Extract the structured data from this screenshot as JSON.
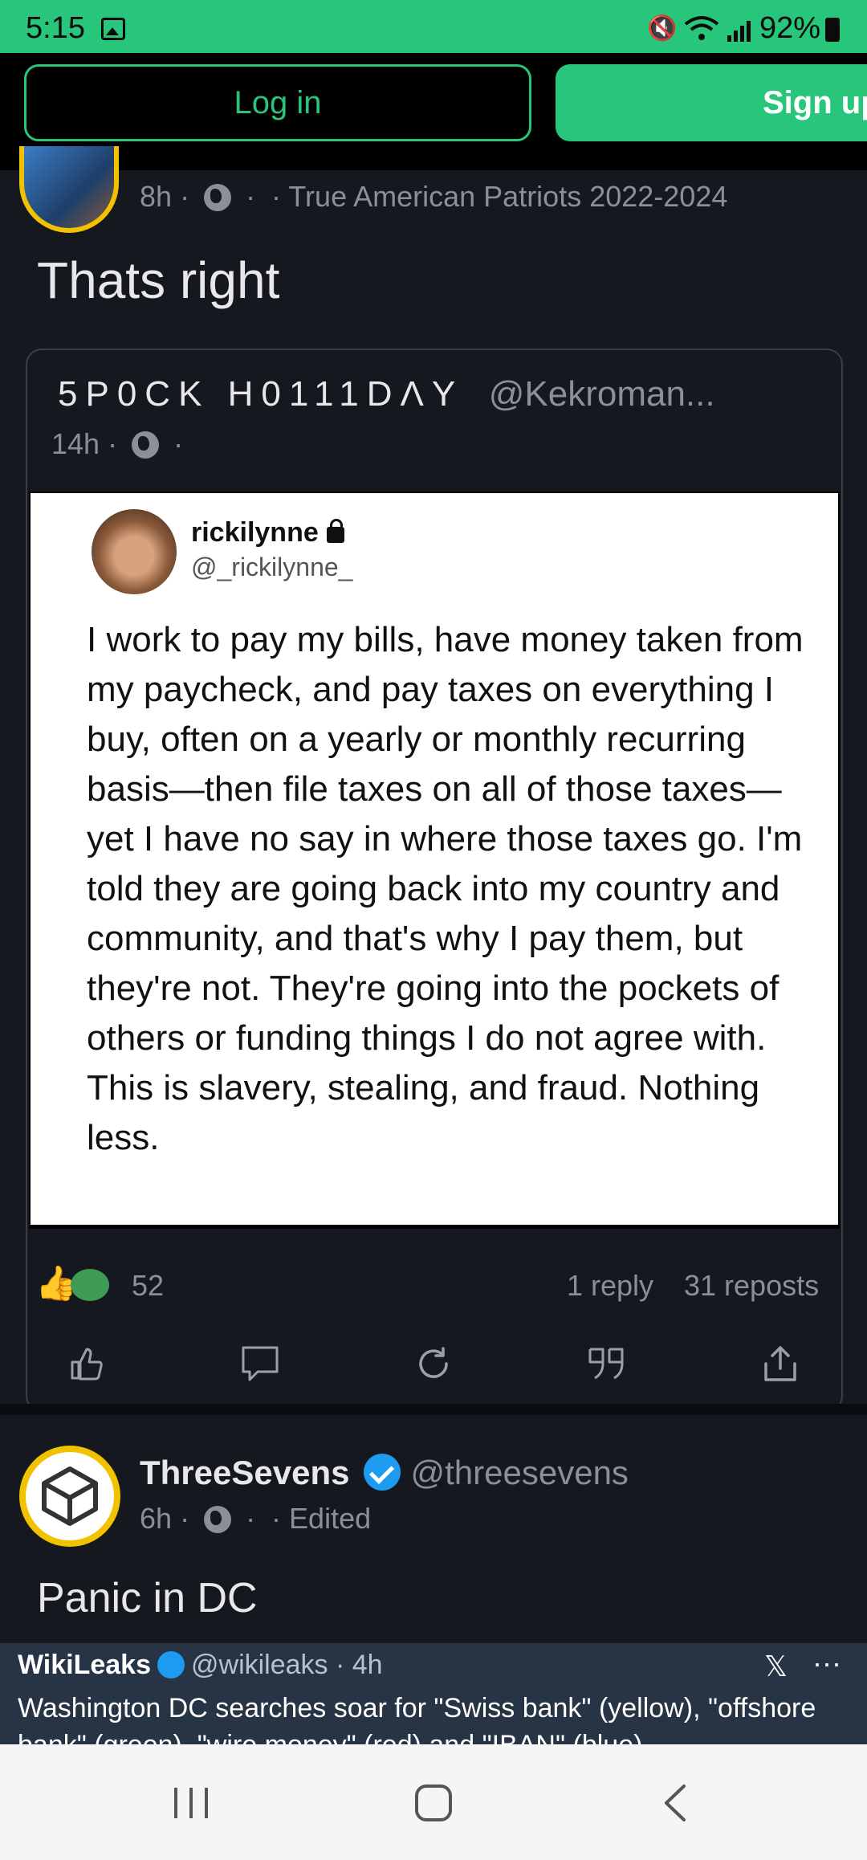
{
  "status_bar": {
    "time": "5:15",
    "battery": "92%"
  },
  "auth": {
    "login_label": "Log in",
    "signup_label": "Sign up"
  },
  "post1": {
    "time": "8h",
    "group": "True American Patriots 2022-2024",
    "text": "Thats right",
    "quote": {
      "author": "5P0CK H0111DΛY",
      "handle": "@Kekroman...",
      "time": "14h",
      "image": {
        "name": "rickilynne",
        "handle": "@_rickilynne_",
        "body": "I work to pay my bills, have money taken from my paycheck, and pay taxes on everything I buy, often on a yearly or monthly recurring basis—then file taxes on all of those taxes—yet I have no say in where those taxes go. I'm told they are going back into my country and community, and that's why I pay them, but they're not. They're going into the pockets of others or funding things I do not agree with. This is slavery, stealing, and fraud. Nothing less."
      }
    },
    "reaction_count": "52",
    "replies": "1 reply",
    "reposts": "31 reposts"
  },
  "post2": {
    "author": "ThreeSevens",
    "handle": "@threesevens",
    "time": "6h",
    "edited": "Edited",
    "text": "Panic in DC",
    "embed": {
      "author": "WikiLeaks",
      "handle": "@wikileaks · 4h",
      "body": "Washington DC searches soar for \"Swiss bank\" (yellow), \"offshore bank\" (green), \"wire money\" (red) and \"IBAN\" (blue)"
    }
  },
  "colors": {
    "accent": "#27c67a",
    "background": "#15181e",
    "verified": "#1d9bf0"
  }
}
